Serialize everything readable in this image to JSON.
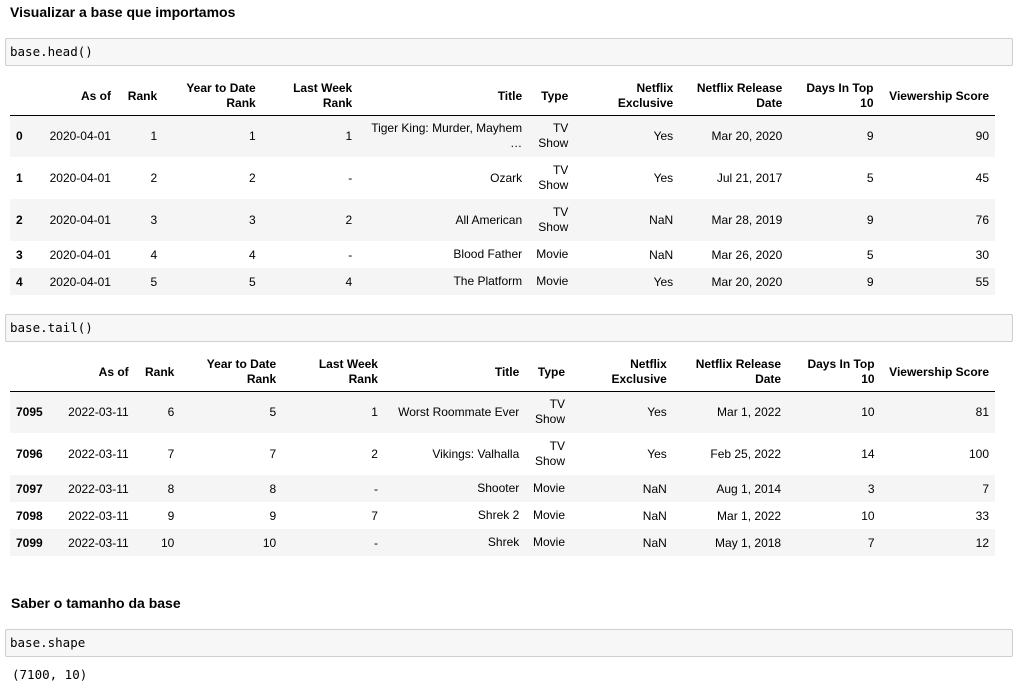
{
  "headings": {
    "view": "Visualizar a base que importamos",
    "size": "Saber o tamanho da base"
  },
  "cells": {
    "head_code": "base.head()",
    "tail_code": "base.tail()",
    "shape_code": "base.shape",
    "shape_output": "(7100, 10)"
  },
  "columns": {
    "as_of": "As of",
    "rank": "Rank",
    "ytd_rank": "Year to Date Rank",
    "last_week_rank": "Last Week Rank",
    "title": "Title",
    "type": "Type",
    "netflix_exclusive": "Netflix Exclusive",
    "release_date": "Netflix Release Date",
    "days_top10": "Days In Top 10",
    "viewership": "Viewership Score"
  },
  "head_rows": [
    {
      "idx": "0",
      "as_of": "2020-04-01",
      "rank": "1",
      "ytd": "1",
      "lw": "1",
      "title": "Tiger King: Murder, Mayhem …",
      "type": "TV Show",
      "excl": "Yes",
      "release": "Mar 20, 2020",
      "days": "9",
      "score": "90"
    },
    {
      "idx": "1",
      "as_of": "2020-04-01",
      "rank": "2",
      "ytd": "2",
      "lw": "-",
      "title": "Ozark",
      "type": "TV Show",
      "excl": "Yes",
      "release": "Jul 21, 2017",
      "days": "5",
      "score": "45"
    },
    {
      "idx": "2",
      "as_of": "2020-04-01",
      "rank": "3",
      "ytd": "3",
      "lw": "2",
      "title": "All American",
      "type": "TV Show",
      "excl": "NaN",
      "release": "Mar 28, 2019",
      "days": "9",
      "score": "76"
    },
    {
      "idx": "3",
      "as_of": "2020-04-01",
      "rank": "4",
      "ytd": "4",
      "lw": "-",
      "title": "Blood Father",
      "type": "Movie",
      "excl": "NaN",
      "release": "Mar 26, 2020",
      "days": "5",
      "score": "30"
    },
    {
      "idx": "4",
      "as_of": "2020-04-01",
      "rank": "5",
      "ytd": "5",
      "lw": "4",
      "title": "The Platform",
      "type": "Movie",
      "excl": "Yes",
      "release": "Mar 20, 2020",
      "days": "9",
      "score": "55"
    }
  ],
  "tail_rows": [
    {
      "idx": "7095",
      "as_of": "2022-03-11",
      "rank": "6",
      "ytd": "5",
      "lw": "1",
      "title": "Worst Roommate Ever",
      "type": "TV Show",
      "excl": "Yes",
      "release": "Mar 1, 2022",
      "days": "10",
      "score": "81"
    },
    {
      "idx": "7096",
      "as_of": "2022-03-11",
      "rank": "7",
      "ytd": "7",
      "lw": "2",
      "title": "Vikings: Valhalla",
      "type": "TV Show",
      "excl": "Yes",
      "release": "Feb 25, 2022",
      "days": "14",
      "score": "100"
    },
    {
      "idx": "7097",
      "as_of": "2022-03-11",
      "rank": "8",
      "ytd": "8",
      "lw": "-",
      "title": "Shooter",
      "type": "Movie",
      "excl": "NaN",
      "release": "Aug 1, 2014",
      "days": "3",
      "score": "7"
    },
    {
      "idx": "7098",
      "as_of": "2022-03-11",
      "rank": "9",
      "ytd": "9",
      "lw": "7",
      "title": "Shrek 2",
      "type": "Movie",
      "excl": "NaN",
      "release": "Mar 1, 2022",
      "days": "10",
      "score": "33"
    },
    {
      "idx": "7099",
      "as_of": "2022-03-11",
      "rank": "10",
      "ytd": "10",
      "lw": "-",
      "title": "Shrek",
      "type": "Movie",
      "excl": "NaN",
      "release": "May 1, 2018",
      "days": "7",
      "score": "12"
    }
  ]
}
